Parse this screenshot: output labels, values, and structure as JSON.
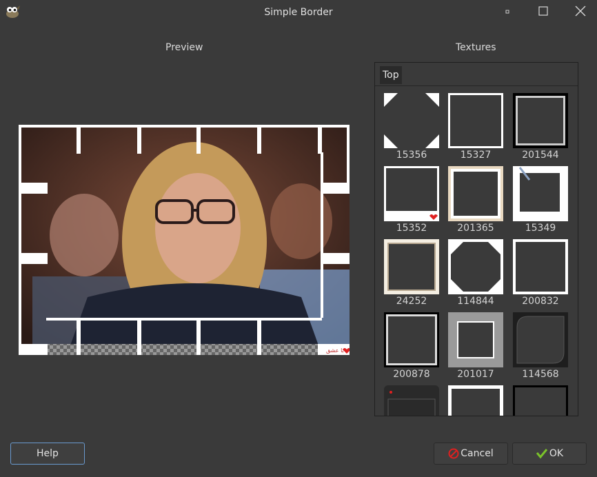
{
  "window": {
    "title": "Simple Border"
  },
  "labels": {
    "preview": "Preview",
    "textures": "Textures"
  },
  "tabs": [
    {
      "label": "Top"
    }
  ],
  "textures": [
    {
      "id": "15356"
    },
    {
      "id": "15327"
    },
    {
      "id": "201544"
    },
    {
      "id": "15352"
    },
    {
      "id": "201365"
    },
    {
      "id": "15349"
    },
    {
      "id": "24252"
    },
    {
      "id": "114844"
    },
    {
      "id": "200832"
    },
    {
      "id": "200878"
    },
    {
      "id": "201017"
    },
    {
      "id": "114568"
    }
  ],
  "preview_overlay": {
    "stamp_text": "با عشق"
  },
  "buttons": {
    "help": "Help",
    "cancel": "Cancel",
    "ok": "OK"
  },
  "icons": {
    "app": "gimp-wilber-icon",
    "minimize": "minimize-icon",
    "maximize": "maximize-icon",
    "close": "close-icon",
    "cancel": "cancel-icon",
    "ok": "checkmark-icon"
  },
  "colors": {
    "focus": "#6a9bd0",
    "cancel_icon": "#e02020",
    "ok_icon": "#7ac22a",
    "window_bg": "#3a3a3a"
  }
}
